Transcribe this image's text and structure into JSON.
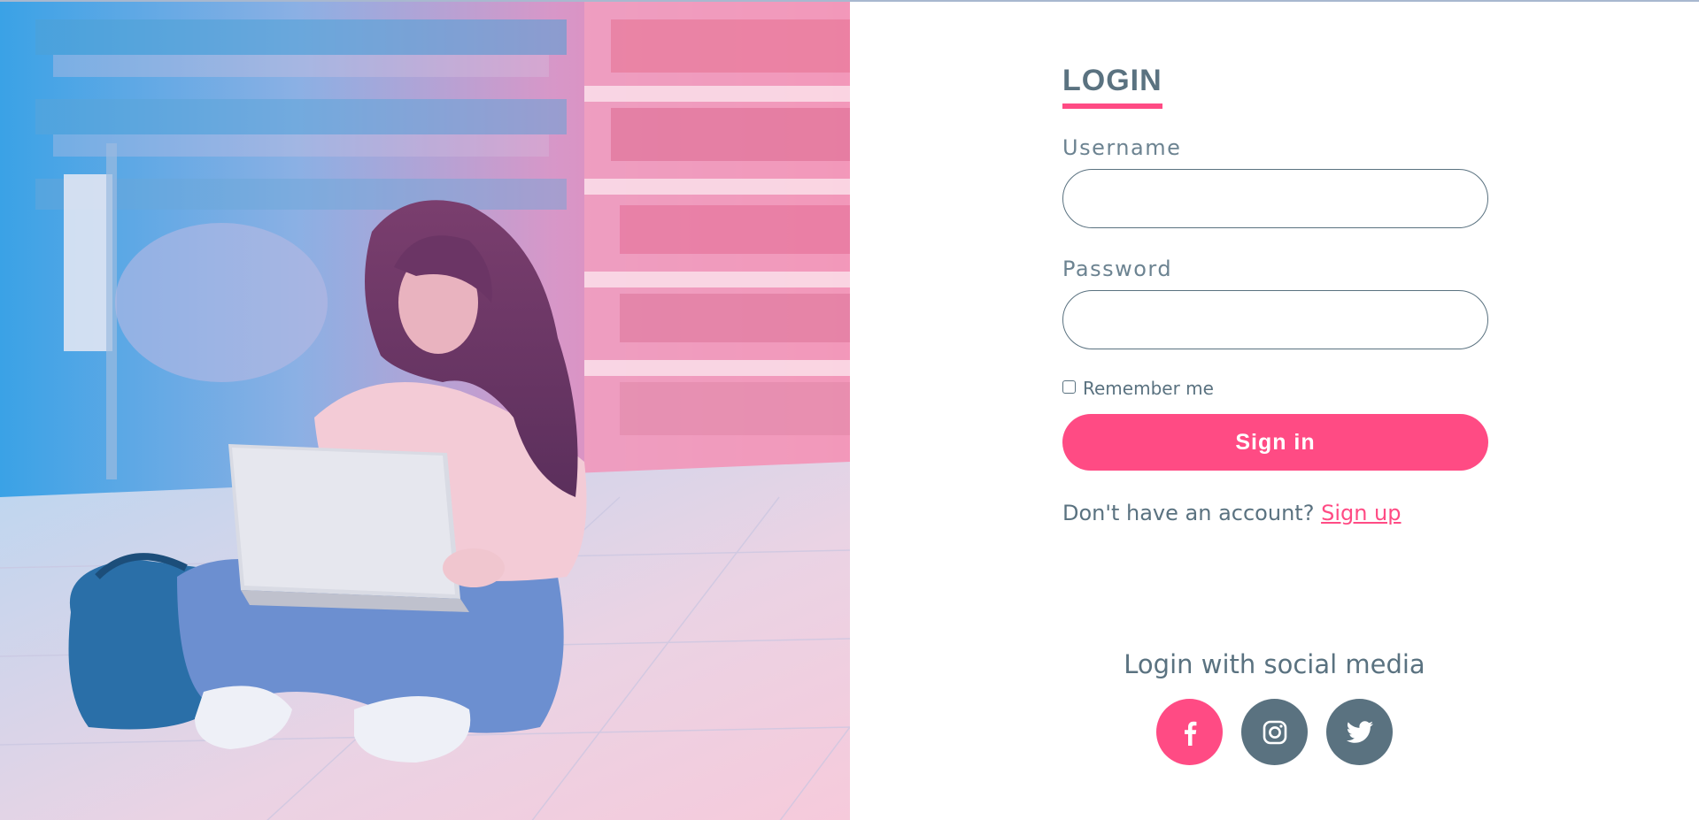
{
  "login": {
    "title": "LOGIN",
    "username_label": "Username",
    "username_value": "",
    "password_label": "Password",
    "password_value": "",
    "remember_label": "Remember me",
    "remember_checked": false,
    "signin_label": "Sign in",
    "no_account_text": "Don't have an account?",
    "signup_link": "Sign up"
  },
  "social": {
    "title": "Login with social media",
    "buttons": [
      {
        "name": "facebook",
        "icon": "facebook-icon",
        "color": "#ff4b84"
      },
      {
        "name": "instagram",
        "icon": "instagram-icon",
        "color": "#5a7280"
      },
      {
        "name": "twitter",
        "icon": "twitter-icon",
        "color": "#5a7280"
      }
    ]
  },
  "colors": {
    "accent": "#ff4b84",
    "text": "#5a7280"
  }
}
